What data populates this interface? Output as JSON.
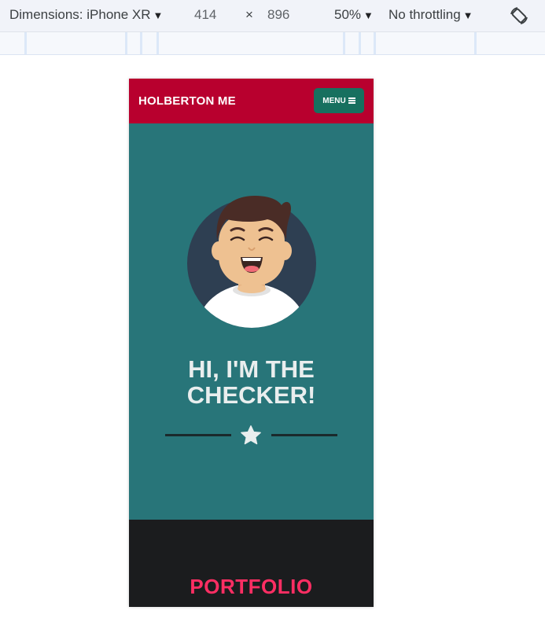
{
  "devtools": {
    "dimensions_label": "Dimensions: iPhone XR",
    "width": "414",
    "times": "×",
    "height": "896",
    "zoom": "50%",
    "throttling": "No throttling",
    "dropdown_icon": "triangle-down-icon",
    "rotate_icon": "rotate-icon"
  },
  "page": {
    "navbar": {
      "brand": "HOLBERTON ME",
      "menu_label": "MENU",
      "menu_icon": "bars-icon"
    },
    "hero": {
      "avatar": "avatar-illustration",
      "headline_line1": "HI, I'M THE",
      "headline_line2": "CHECKER!",
      "divider_icon": "star-icon"
    },
    "portfolio": {
      "title": "PORTFOLIO"
    }
  },
  "colors": {
    "navbar_bg": "#b8002e",
    "menu_button_bg": "#17705f",
    "hero_bg": "#287579",
    "headline_text": "#e9eeee",
    "portfolio_bg": "#1b1c1e",
    "portfolio_title": "#ff2e63"
  }
}
